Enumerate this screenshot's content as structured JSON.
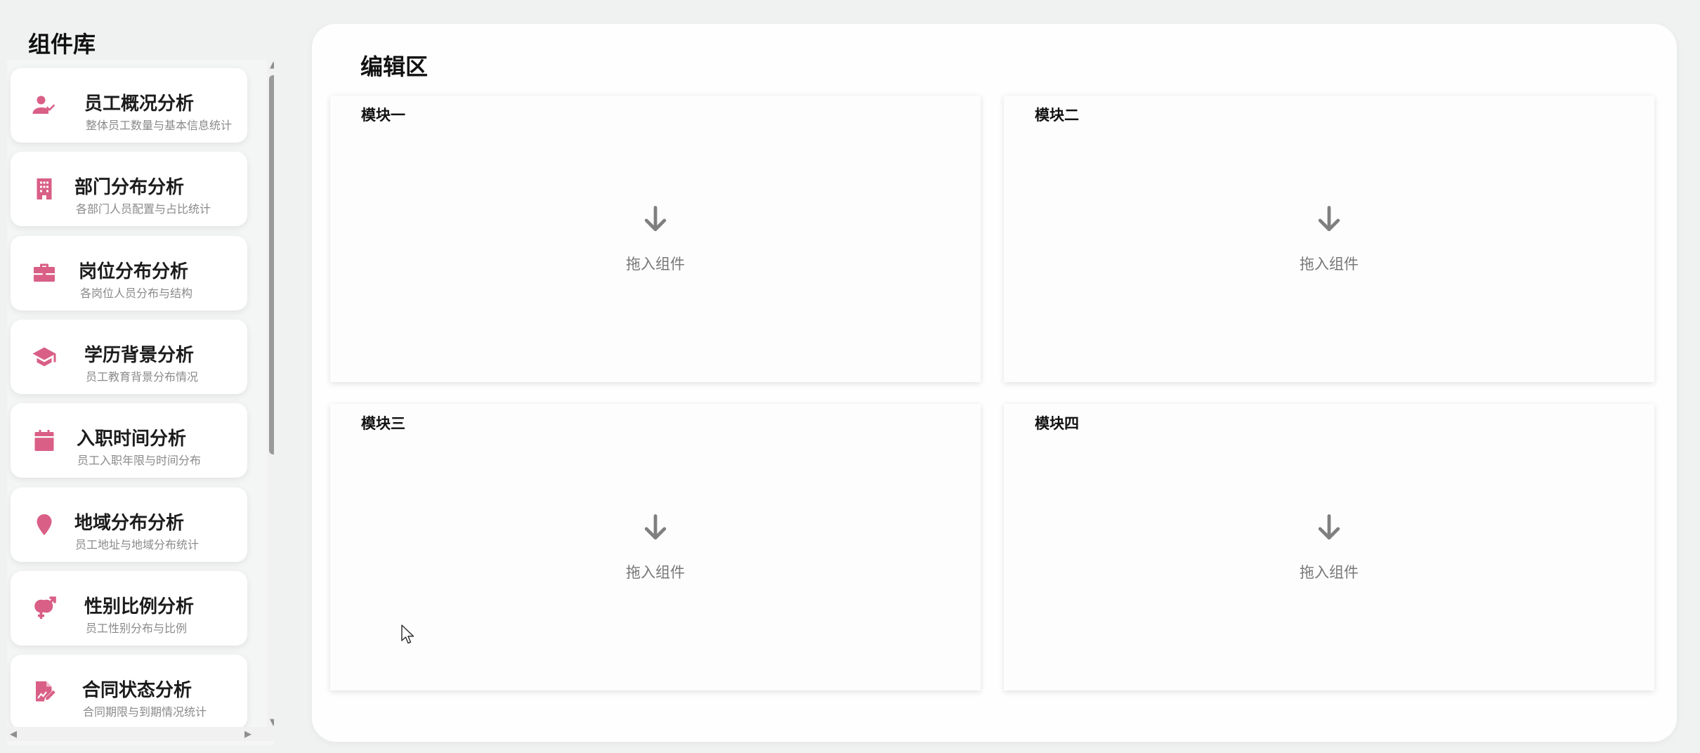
{
  "sidebar": {
    "title": "组件库",
    "items": [
      {
        "title": "员工概况分析",
        "desc": "整体员工数量与基本信息统计",
        "icon": "user-check-icon"
      },
      {
        "title": "部门分布分析",
        "desc": "各部门人员配置与占比统计",
        "icon": "building-icon"
      },
      {
        "title": "岗位分布分析",
        "desc": "各岗位人员分布与结构",
        "icon": "briefcase-icon"
      },
      {
        "title": "学历背景分析",
        "desc": "员工教育背景分布情况",
        "icon": "graduation-cap-icon"
      },
      {
        "title": "入职时间分析",
        "desc": "员工入职年限与时间分布",
        "icon": "calendar-icon"
      },
      {
        "title": "地域分布分析",
        "desc": "员工地址与地域分布统计",
        "icon": "map-pin-icon"
      },
      {
        "title": "性别比例分析",
        "desc": "员工性别分布与比例",
        "icon": "gender-icon"
      },
      {
        "title": "合同状态分析",
        "desc": "合同期限与到期情况统计",
        "icon": "contract-sign-icon"
      }
    ]
  },
  "editor": {
    "title": "编辑区",
    "modules": [
      {
        "title": "模块一",
        "placeholder": "拖入组件"
      },
      {
        "title": "模块二",
        "placeholder": "拖入组件"
      },
      {
        "title": "模块三",
        "placeholder": "拖入组件"
      },
      {
        "title": "模块四",
        "placeholder": "拖入组件"
      }
    ]
  },
  "colors": {
    "accent": "#d95f86",
    "background": "#f0f2f1",
    "panel": "#fefefe",
    "muted_text": "#777777"
  }
}
